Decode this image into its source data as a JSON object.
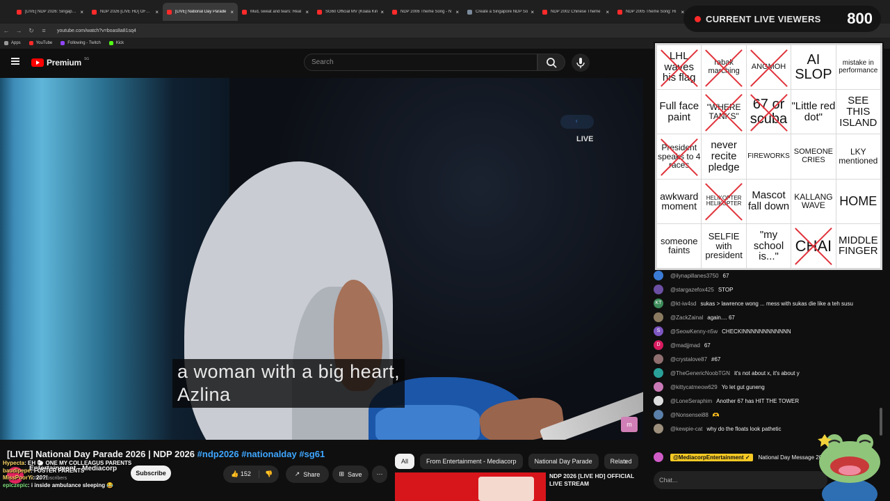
{
  "browser": {
    "tabs": [
      {
        "label": "[LIVE] NDP 2026: Singapore",
        "active": false
      },
      {
        "label": "NDP 2026 [LIVE HD] OFFICIAL",
        "active": false
      },
      {
        "label": "[LIVE] National Day Parade",
        "active": true
      },
      {
        "label": "Mud, sweat and tears: Real",
        "active": false
      },
      {
        "label": "SG60 Official MV (Koala Kin",
        "active": false
      },
      {
        "label": "NDP 2006 Theme Song - N",
        "active": false
      },
      {
        "label": "Create a Singapore NDP So",
        "active": false
      },
      {
        "label": "NDP 2002 Chinese Theme",
        "active": false
      },
      {
        "label": "NDP 2005 Theme Song: Ri",
        "active": false
      }
    ],
    "url": "youtube.com/watch?v=boas8a81sq4",
    "bookmarks": [
      "Apps",
      "YouTube",
      "Following - Twitch",
      "Kick"
    ]
  },
  "youtube": {
    "logo": "Premium",
    "region": "SG",
    "search_placeholder": "Search"
  },
  "video": {
    "caption_line1": "a woman with a big heart,",
    "caption_line2": "Azlina",
    "live_label": "LIVE",
    "title_main": "[LIVE] National Day Parade 2026 | NDP 2026",
    "title_tags": "#ndp2026 #nationalday #sg61",
    "channel": "Entertainment - Mediacorp",
    "subscribers": "600K subscribers",
    "subscribe_label": "Subscribe",
    "likes": "152",
    "share_label": "Share",
    "save_label": "Save"
  },
  "overlay_chat": [
    {
      "user": "Hypecta",
      "text": "EH 🐑 ONE MY COLLEAGUS PARENTS"
    },
    {
      "user": "baudipepe",
      "text": "FOSTER PARENTS"
    },
    {
      "user": "MissPoorYi",
      "text": "20?!"
    },
    {
      "user": "epiczepic",
      "text": "i inside ambulance sleeping 😂"
    }
  ],
  "chips": [
    "All",
    "From Entertainment - Mediacorp",
    "National Day Parade",
    "Related"
  ],
  "recommended": {
    "title": "NDP 2026 [LIVE HD] OFFICIAL LIVE STREAM"
  },
  "viewers": {
    "label": "CURRENT LIVE VIEWERS",
    "count": "800"
  },
  "bingo": [
    {
      "text": "LHL waves his flag",
      "x": true,
      "size": 15
    },
    {
      "text": "rabak marching",
      "x": true,
      "size": 11
    },
    {
      "text": "ANGMOH",
      "x": true,
      "size": 11
    },
    {
      "text": "AI SLOP",
      "x": false,
      "size": 20
    },
    {
      "text": "mistake in performance",
      "x": false,
      "size": 10
    },
    {
      "text": "Full face paint",
      "x": false,
      "size": 15
    },
    {
      "text": "\"WHERE TANKS\"",
      "x": true,
      "size": 12
    },
    {
      "text": "67 or scuba",
      "x": true,
      "size": 20
    },
    {
      "text": "\"Little red dot\"",
      "x": false,
      "size": 15
    },
    {
      "text": "SEE THIS ISLAND",
      "x": false,
      "size": 15
    },
    {
      "text": "President speaks to 4 races",
      "x": true,
      "size": 12
    },
    {
      "text": "never recite pledge",
      "x": false,
      "size": 15
    },
    {
      "text": "FIREWORKS",
      "x": false,
      "size": 10
    },
    {
      "text": "SOMEONE CRIES",
      "x": false,
      "size": 11
    },
    {
      "text": "LKY mentioned",
      "x": false,
      "size": 12
    },
    {
      "text": "awkward moment",
      "x": false,
      "size": 14
    },
    {
      "text": "HELIKOPTER HELIKOPTER",
      "x": true,
      "size": 8
    },
    {
      "text": "Mascot fall down",
      "x": false,
      "size": 15
    },
    {
      "text": "KALLANG WAVE",
      "x": false,
      "size": 12
    },
    {
      "text": "HOME",
      "x": false,
      "size": 18
    },
    {
      "text": "someone faints",
      "x": false,
      "size": 13
    },
    {
      "text": "SELFIE with president",
      "x": false,
      "size": 13
    },
    {
      "text": "\"my school is...\"",
      "x": false,
      "size": 15
    },
    {
      "text": "CHAI",
      "x": true,
      "size": 22
    },
    {
      "text": "MIDDLE FINGER",
      "x": false,
      "size": 15
    }
  ],
  "chat": [
    {
      "user": "@ilynapillanes3750",
      "text": "67",
      "color": "#3a7bd5",
      "initial": ""
    },
    {
      "user": "@stargazefox425",
      "text": "STOP",
      "color": "#6b4fa3",
      "initial": ""
    },
    {
      "user": "@kt-iw4sd",
      "text": "sukas > lawrence wong ... mess with sukas die like a teh susu",
      "color": "#3d8b5a",
      "initial": "KT"
    },
    {
      "user": "@ZackZainal",
      "text": "again.... 67",
      "color": "#8a7a60",
      "initial": ""
    },
    {
      "user": "@SeowKenny-n5w",
      "text": "CHECKINNNNNNNNNNNN",
      "color": "#7e57c2",
      "initial": "S"
    },
    {
      "user": "@madjjmad",
      "text": "67",
      "color": "#d81b60",
      "initial": "D"
    },
    {
      "user": "@crystalove87",
      "text": "#67",
      "color": "#8e6e6e",
      "initial": ""
    },
    {
      "user": "@TheGenericNoobTGN",
      "text": "it's not about x, it's about y",
      "color": "#2aa198",
      "initial": ""
    },
    {
      "user": "@kittycatmeow629",
      "text": "Yo let gut guneng",
      "color": "#c979b5",
      "initial": ""
    },
    {
      "user": "@LoneSeraphim",
      "text": "Another 67 has HIT THE TOWER",
      "color": "#dddddd",
      "initial": ""
    },
    {
      "user": "@Nonsensei88",
      "text": "🫶",
      "color": "#5a7fa8",
      "initial": ""
    },
    {
      "user": "@kewpie-cat",
      "text": "why do the floats look pathetic",
      "color": "#9c8f7c",
      "initial": ""
    }
  ],
  "pinned": {
    "user": "@MediacorpEntertainment ✓",
    "text": "National Day Message 20"
  },
  "chat_placeholder": "Chat..."
}
